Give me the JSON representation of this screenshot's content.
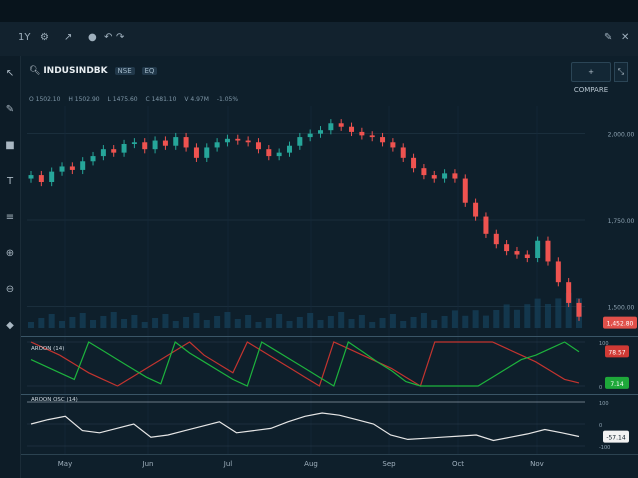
{
  "toolbar": {
    "interval_label": "1Y",
    "indicators_label": "⚙",
    "draw_label": "↗",
    "circle_label": "●",
    "undo_label": "↶",
    "redo_label": "↷",
    "pen_label": "✎",
    "close_label": "✕"
  },
  "header": {
    "symbol": "INDUSINDBK",
    "exchange": "NSE",
    "segment": "EQ",
    "compare_label": "+ COMPARE",
    "expand_label": "⤡"
  },
  "ohlc": [
    "O 1502.10",
    "H 1502.90",
    "L 1475.60",
    "C 1481.10",
    "V 4.97M",
    "-1.05%"
  ],
  "price_axis": [
    "2,000.00",
    "1,750.00",
    "1,500.00"
  ],
  "last_price_label": "1,452.80",
  "aroon": {
    "name": "AROON (14)",
    "up_value": "78.57",
    "down_value": "7.14",
    "axis_labels": [
      "100",
      "0"
    ]
  },
  "aroon_osc": {
    "name": "AROON OSC (14)",
    "value": "-57.14",
    "axis_labels": [
      "100",
      "0",
      "-100"
    ]
  },
  "x_axis": [
    "May",
    "Jun",
    "Jul",
    "Aug",
    "Sep",
    "Oct",
    "Nov"
  ],
  "colors": {
    "up_candle": "#26a69a",
    "down_candle": "#ef5350",
    "aroon_up": "#1db33d",
    "aroon_down": "#c3342f",
    "osc_line": "#e6e6e6"
  },
  "chart_data": [
    {
      "type": "line",
      "series": [
        {
          "values": [
            1880,
            1860,
            1890,
            1905,
            1895,
            1920,
            1935,
            1955,
            1945,
            1970,
            1975,
            1955,
            1980,
            1965,
            1990,
            1960,
            1930,
            1960,
            1975,
            1985,
            1980,
            1975,
            1955,
            1935,
            1945,
            1965,
            1990,
            2000,
            2010,
            2030,
            2020,
            2005,
            1995,
            1990,
            1975,
            1960,
            1930,
            1900,
            1880,
            1870,
            1885,
            1870,
            1800,
            1760,
            1710,
            1680,
            1660,
            1650,
            1640,
            1690,
            1630,
            1570,
            1510,
            1470
          ]
        }
      ],
      "y_ticks": [
        "2,000.00",
        "1,750.00",
        "1,500.00"
      ]
    },
    {
      "type": "line",
      "ylim": [
        0,
        100
      ],
      "series": [
        {
          "name": "up",
          "values": [
            60,
            45,
            30,
            15,
            100,
            80,
            60,
            40,
            20,
            5,
            100,
            75,
            55,
            35,
            15,
            0,
            100,
            80,
            60,
            40,
            20,
            0,
            100,
            78,
            55,
            35,
            10,
            0,
            0,
            0,
            0,
            0,
            20,
            40,
            60,
            70,
            85,
            100,
            78
          ]
        },
        {
          "name": "down",
          "values": [
            100,
            85,
            70,
            50,
            30,
            15,
            0,
            20,
            40,
            60,
            80,
            100,
            70,
            50,
            30,
            100,
            80,
            60,
            40,
            20,
            0,
            100,
            85,
            70,
            55,
            40,
            20,
            0,
            100,
            100,
            100,
            100,
            100,
            85,
            70,
            55,
            35,
            15,
            7
          ]
        }
      ]
    },
    {
      "type": "line",
      "ylim": [
        -100,
        100
      ],
      "series": [
        {
          "values": [
            0,
            20,
            35,
            -30,
            -40,
            -20,
            0,
            -60,
            -50,
            -30,
            -10,
            10,
            -40,
            -30,
            -20,
            10,
            35,
            50,
            40,
            20,
            0,
            -50,
            -70,
            -65,
            -60,
            -55,
            -50,
            -75,
            -60,
            -45,
            -25,
            -40,
            -57
          ]
        }
      ]
    }
  ]
}
